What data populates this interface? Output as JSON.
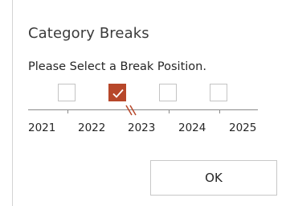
{
  "dialog": {
    "title": "Category Breaks",
    "prompt": "Please Select a Break Position.",
    "ok_label": "OK"
  },
  "break_positions": [
    {
      "checked": false
    },
    {
      "checked": true
    },
    {
      "checked": false
    },
    {
      "checked": false
    }
  ],
  "years": [
    "2021",
    "2022",
    "2023",
    "2024",
    "2025"
  ],
  "colors": {
    "accent": "#b7472a"
  },
  "icons": {
    "check": "checkmark-icon",
    "break": "axis-break-icon"
  }
}
